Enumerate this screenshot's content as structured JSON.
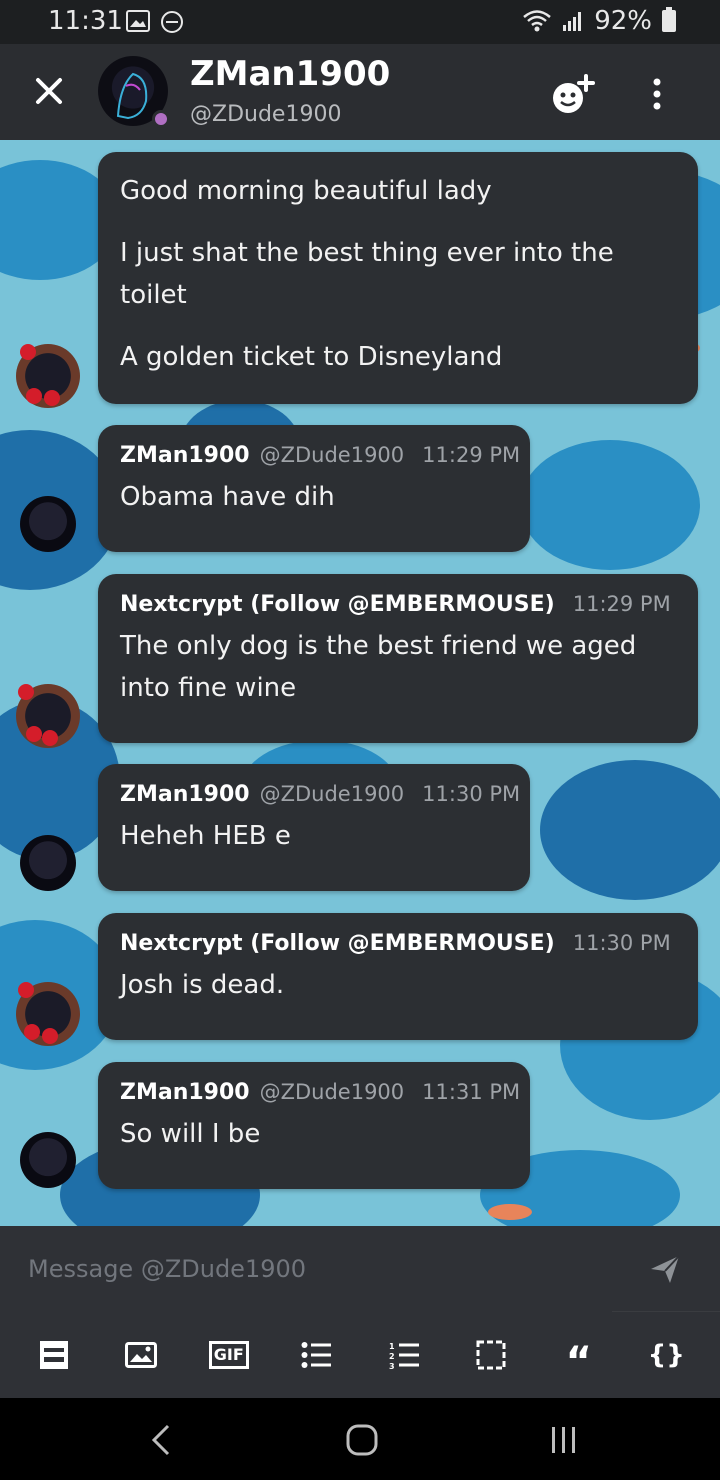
{
  "status_bar": {
    "time": "11:31",
    "battery": "92%"
  },
  "header": {
    "name": "ZMan1900",
    "handle": "@ZDude1900"
  },
  "messages": [
    {
      "author": "",
      "handle": "",
      "time": "",
      "lines": [
        "Good morning beautiful lady",
        "I just shat the best thing ever into the toilet",
        "A golden ticket to Disneyland"
      ]
    },
    {
      "author": "ZMan1900",
      "handle": "@ZDude1900",
      "time": "11:29 PM",
      "text": "Obama have dih"
    },
    {
      "author": "Nextcrypt (Follow @EMBERMOUSE)",
      "handle": "",
      "time": "11:29 PM",
      "text": "The only dog is the best friend we aged into fine wine"
    },
    {
      "author": "ZMan1900",
      "handle": "@ZDude1900",
      "time": "11:30 PM",
      "text": "Heheh HEB e"
    },
    {
      "author": "Nextcrypt (Follow @EMBERMOUSE)",
      "handle": "",
      "time": "11:30 PM",
      "text": "Josh is dead."
    },
    {
      "author": "ZMan1900",
      "handle": "@ZDude1900",
      "time": "11:31 PM",
      "text": "So will I be"
    }
  ],
  "composer": {
    "placeholder": "Message @ZDude1900"
  },
  "toolbar": {
    "gif_label": "GIF",
    "quote_label": "“",
    "code_label": "{}"
  },
  "colors": {
    "accent_presence": "#b06fc3",
    "bubble": "#2c2f33",
    "chat_bg": "#79c3d8"
  }
}
